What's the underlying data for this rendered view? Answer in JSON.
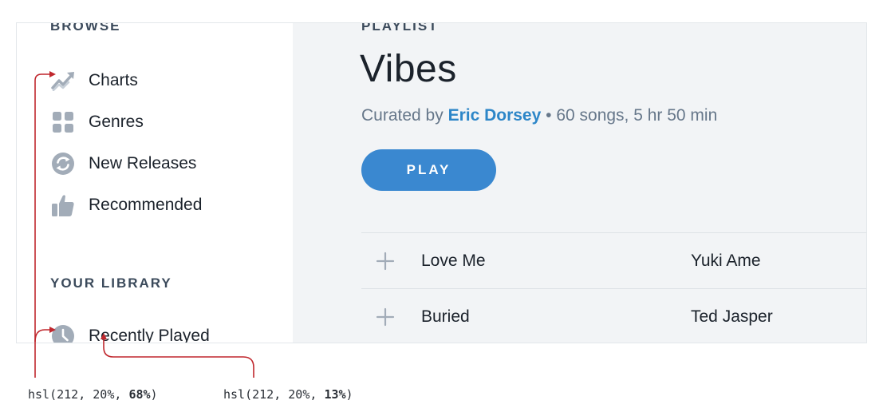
{
  "sidebar": {
    "browse_heading": "BROWSE",
    "browse_items": [
      {
        "label": "Charts",
        "icon": "trending-chart-icon"
      },
      {
        "label": "Genres",
        "icon": "grid-icon"
      },
      {
        "label": "New Releases",
        "icon": "refresh-icon"
      },
      {
        "label": "Recommended",
        "icon": "thumbs-up-icon"
      }
    ],
    "library_heading": "YOUR LIBRARY",
    "library_items": [
      {
        "label": "Recently Played",
        "icon": "clock-icon"
      }
    ]
  },
  "main": {
    "kicker": "PLAYLIST",
    "title": "Vibes",
    "meta_prefix": "Curated by ",
    "curator": "Eric Dorsey",
    "meta_suffix": " • 60 songs, 5 hr 50 min",
    "play_label": "PLAY",
    "tracks": [
      {
        "title": "Love Me",
        "artist": "Yuki Ame"
      },
      {
        "title": "Buried",
        "artist": "Ted Jasper"
      }
    ]
  },
  "annotations": {
    "icon_color": {
      "prefix": "hsl(212, 20%, ",
      "value": "68%",
      "suffix": ")"
    },
    "text_color": {
      "prefix": "hsl(212, 20%, ",
      "value": "13%",
      "suffix": ")"
    }
  },
  "colors": {
    "icon": "#a2acb8",
    "text": "#1b222b",
    "accent": "#3a88d0",
    "link": "#2d86c8",
    "annotation_line": "#c0272d",
    "main_background": "#f2f4f6"
  }
}
